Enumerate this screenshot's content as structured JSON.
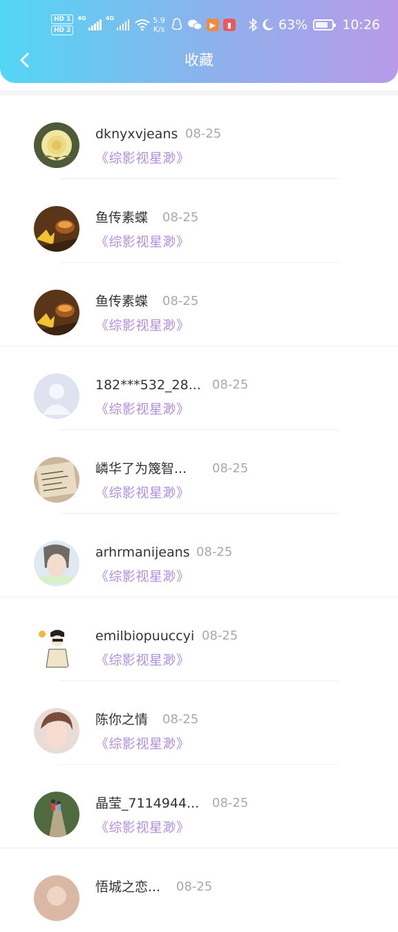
{
  "status": {
    "hd1": "HD 1",
    "hd2": "HD 2",
    "net1": "4G",
    "net2": "4G",
    "speed_value": "5.9",
    "speed_unit": "K/s",
    "battery": "63%",
    "time": "10:26"
  },
  "header": {
    "title": "收藏"
  },
  "items": [
    {
      "name": "dknyxvjeans",
      "date": "08-25",
      "subtitle": "《综影视星渺》"
    },
    {
      "name": "鱼传素蝶",
      "date": "08-25",
      "subtitle": "《综影视星渺》"
    },
    {
      "name": "鱼传素蝶",
      "date": "08-25",
      "subtitle": "《综影视星渺》"
    },
    {
      "name": "182***532_28...",
      "date": "08-25",
      "subtitle": "《综影视星渺》"
    },
    {
      "name": "嶙华了为篾智...",
      "date": "08-25",
      "subtitle": "《综影视星渺》"
    },
    {
      "name": "arhrmanijeans",
      "date": "08-25",
      "subtitle": "《综影视星渺》"
    },
    {
      "name": "emilbiopuuccyi",
      "date": "08-25",
      "subtitle": "《综影视星渺》"
    },
    {
      "name": "陈你之情",
      "date": "08-25",
      "subtitle": "《综影视星渺》"
    },
    {
      "name": "晶莹_7114944...",
      "date": "08-25",
      "subtitle": "《综影视星渺》"
    },
    {
      "name": "悟城之恋...",
      "date": "08-25",
      "subtitle": ""
    }
  ],
  "colors": {
    "accent": "#b38ee0",
    "header_start": "#52d6f5",
    "header_end": "#b99ae8"
  }
}
